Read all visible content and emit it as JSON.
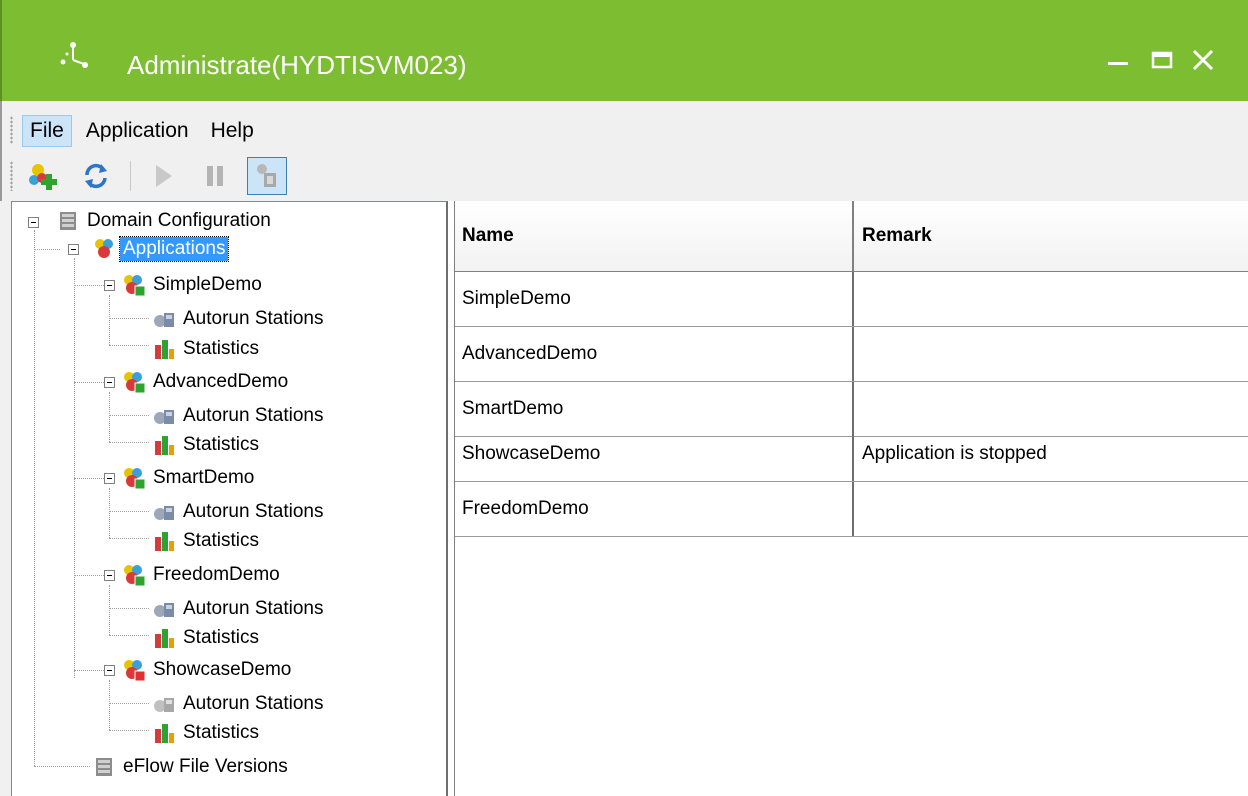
{
  "window": {
    "title": "Administrate(HYDTISVM023)",
    "accent_color": "#7dbd31"
  },
  "menu": {
    "items": [
      {
        "label": "File",
        "active": true
      },
      {
        "label": "Application",
        "active": false
      },
      {
        "label": "Help",
        "active": false
      }
    ]
  },
  "toolbar": {
    "buttons": [
      "add-application-icon",
      "refresh-icon",
      "play-icon",
      "pause-icon",
      "autorun-toggle-icon"
    ]
  },
  "tree": {
    "root": "Domain Configuration",
    "applications": "Applications",
    "apps": [
      {
        "name": "SimpleDemo",
        "autorun": "Autorun Stations",
        "statistics": "Statistics"
      },
      {
        "name": "AdvancedDemo",
        "autorun": "Autorun Stations",
        "statistics": "Statistics"
      },
      {
        "name": "SmartDemo",
        "autorun": "Autorun Stations",
        "statistics": "Statistics"
      },
      {
        "name": "FreedomDemo",
        "autorun": "Autorun Stations",
        "statistics": "Statistics"
      },
      {
        "name": "ShowcaseDemo",
        "autorun": "Autorun Stations",
        "statistics": "Statistics"
      }
    ],
    "file_versions": "eFlow File Versions"
  },
  "grid": {
    "columns": [
      "Name",
      "Remark"
    ],
    "rows": [
      {
        "name": "SimpleDemo",
        "remark": ""
      },
      {
        "name": "AdvancedDemo",
        "remark": ""
      },
      {
        "name": "SmartDemo",
        "remark": ""
      },
      {
        "name": "ShowcaseDemo",
        "remark": "Application is stopped"
      },
      {
        "name": "FreedomDemo",
        "remark": ""
      }
    ]
  }
}
